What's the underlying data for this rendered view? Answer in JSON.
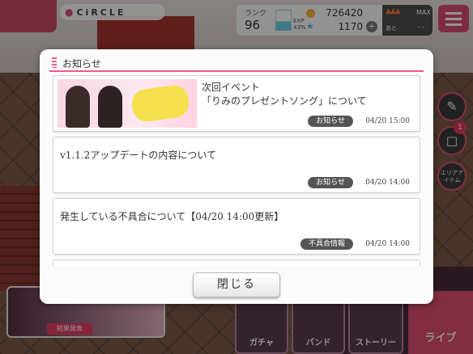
{
  "hud": {
    "location": "CiRCLE",
    "rank_label": "ランク",
    "rank": "96",
    "exp_label": "EXP",
    "exp_percent": "43%",
    "exp_fraction": 0.43,
    "coins": "726420",
    "stars": "1170",
    "stamina_max": "MAX",
    "stamina_remaining_label": "あと",
    "stamina_remaining": "- -",
    "gift_badge": "1",
    "area_item_label": "エリアアイテム"
  },
  "bottom_nav": {
    "banner_caption": "結果発表",
    "gacha": "ガチャ",
    "band": "バンド",
    "story": "ストーリー",
    "live": "ライブ"
  },
  "modal": {
    "title": "お知らせ",
    "close_label": "閉じる",
    "items": [
      {
        "title_line1": "次回イベント",
        "title_line2": "「りみのプレゼントソング」について",
        "tag": "お知らせ",
        "date": "04/20 15:00"
      },
      {
        "title_line1": "v1.1.2アップデートの内容について",
        "tag": "お知らせ",
        "date": "04/20 14:00"
      },
      {
        "title_line1": "発生している不具合について【04/20 14:00更新】",
        "tag": "不具合情報",
        "date": "04/20 14:00"
      }
    ]
  },
  "colors": {
    "accent": "#f25a86",
    "tag_bg": "#555555"
  }
}
